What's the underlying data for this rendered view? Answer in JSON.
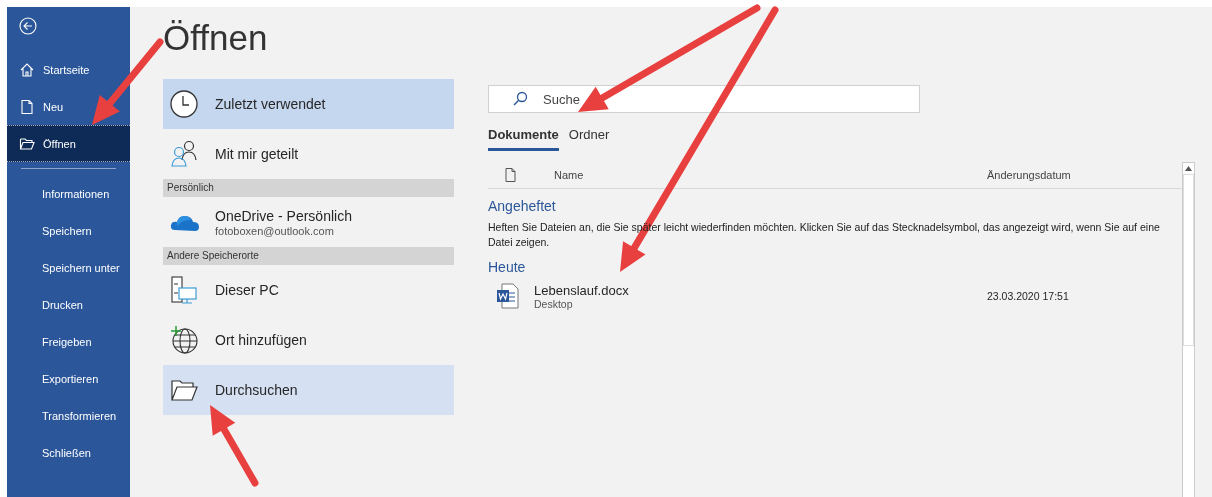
{
  "sidebar": {
    "items": [
      {
        "label": "Startseite",
        "kind": "primary",
        "selected": false
      },
      {
        "label": "Neu",
        "kind": "primary",
        "selected": false
      },
      {
        "label": "Öffnen",
        "kind": "primary",
        "selected": true
      },
      {
        "label": "Informationen",
        "kind": "secondary",
        "selected": false
      },
      {
        "label": "Speichern",
        "kind": "secondary",
        "selected": false
      },
      {
        "label": "Speichern unter",
        "kind": "secondary",
        "selected": false
      },
      {
        "label": "Drucken",
        "kind": "secondary",
        "selected": false
      },
      {
        "label": "Freigeben",
        "kind": "secondary",
        "selected": false
      },
      {
        "label": "Exportieren",
        "kind": "secondary",
        "selected": false
      },
      {
        "label": "Transformieren",
        "kind": "secondary",
        "selected": false
      },
      {
        "label": "Schließen",
        "kind": "secondary",
        "selected": false
      }
    ]
  },
  "page_title": "Öffnen",
  "locations": [
    {
      "kind": "option",
      "label": "Zuletzt verwendet",
      "selected": true
    },
    {
      "kind": "option",
      "label": "Mit mir geteilt",
      "selected": false
    },
    {
      "kind": "header",
      "label": "Persönlich"
    },
    {
      "kind": "option",
      "label": "OneDrive - Persönlich",
      "sublabel": "fotoboxen@outlook.com",
      "selected": false
    },
    {
      "kind": "header",
      "label": "Andere Speicherorte"
    },
    {
      "kind": "option",
      "label": "Dieser PC",
      "selected": false
    },
    {
      "kind": "option",
      "label": "Ort hinzufügen",
      "selected": false
    },
    {
      "kind": "option",
      "label": "Durchsuchen",
      "selected": false,
      "hover": true
    }
  ],
  "search": {
    "placeholder": "Suche"
  },
  "tabs": [
    {
      "label": "Dokumente",
      "selected": true
    },
    {
      "label": "Ordner",
      "selected": false
    }
  ],
  "file_list": {
    "columns": [
      "Name",
      "Änderungsdatum"
    ],
    "groups": [
      {
        "title": "Angeheftet",
        "note": "Heften Sie Dateien an, die Sie später leicht wiederfinden möchten. Klicken Sie auf das Stecknadelsymbol, das angezeigt wird, wenn Sie auf eine Datei zeigen."
      },
      {
        "title": "Heute",
        "files": [
          {
            "name": "Lebenslauf.docx",
            "location": "Desktop",
            "modified": "23.03.2020 17:51"
          }
        ]
      }
    ]
  }
}
